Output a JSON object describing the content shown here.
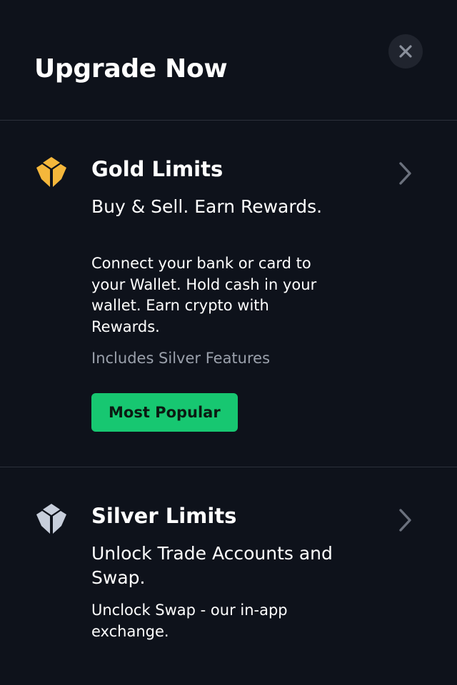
{
  "header": {
    "title": "Upgrade Now",
    "close_icon": "close-icon"
  },
  "tiers": [
    {
      "name": "Gold Limits",
      "icon": "gold-tier-icon",
      "icon_color": "#f5b73b",
      "tagline": "Buy & Sell. Earn Rewards.",
      "description": "Connect your bank or card to your Wallet. Hold cash in your wallet. Earn crypto with Rewards.",
      "includes": "Includes Silver Features",
      "badge": "Most Popular",
      "badge_color": "#17c771"
    },
    {
      "name": "Silver Limits",
      "icon": "silver-tier-icon",
      "icon_color": "#c7cedb",
      "tagline": "Unlock Trade Accounts and Swap.",
      "description": "Unclock Swap - our in-app exchange."
    }
  ],
  "colors": {
    "background": "#0e121b",
    "divider": "#2c313b",
    "muted_text": "#9aa0ab",
    "chevron": "#6b717d"
  }
}
